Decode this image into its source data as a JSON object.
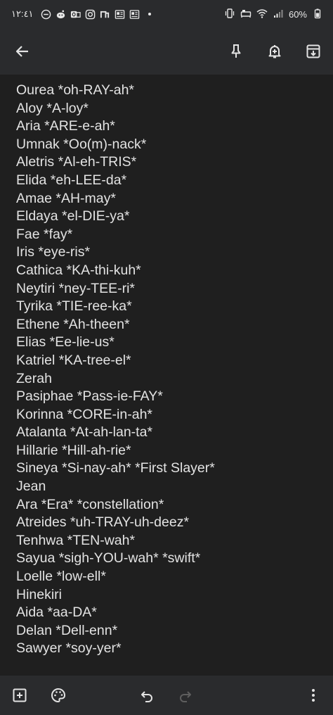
{
  "status_bar": {
    "time": "١٢:٤١",
    "left_icons": [
      "do-not-disturb-icon",
      "reddit-icon",
      "outlook-icon",
      "instagram-icon",
      "app-icon",
      "news-icon",
      "news-icon"
    ],
    "battery": "60%",
    "right_icons": [
      "vibrate-icon",
      "alarm-icon",
      "wifi-icon",
      "signal-icon",
      "battery-icon"
    ]
  },
  "toolbar": {
    "icons": [
      "back-arrow-icon",
      "pin-icon",
      "add-reminder-icon",
      "archive-icon"
    ]
  },
  "note": {
    "lines": [
      "Ourea *oh-RAY-ah*",
      "Aloy *A-loy*",
      "Aria *ARE-e-ah*",
      "Umnak *Oo(m)-nack*",
      "Aletris *Al-eh-TRIS*",
      "Elida *eh-LEE-da*",
      "Amae *AH-may*",
      "Eldaya *el-DIE-ya*",
      "Fae *fay*",
      "Iris *eye-ris*",
      "Cathica *KA-thi-kuh*",
      "Neytiri *ney-TEE-ri*",
      "Tyrika *TIE-ree-ka*",
      "Ethene *Ah-theen*",
      "Elias *Ee-lie-us*",
      "Katriel *KA-tree-el*",
      "Zerah",
      "Pasiphae *Pass-ie-FAY*",
      "Korinna *CORE-in-ah*",
      "Atalanta *At-ah-lan-ta*",
      "Hillarie *Hill-ah-rie*",
      "Sineya *Si-nay-ah* *First Slayer*",
      "Jean",
      "Ara *Era* *constellation*",
      "Atreides *uh-TRAY-uh-deez*",
      "Tenhwa *TEN-wah*",
      "Sayua *sigh-YOU-wah* *swift*",
      "Loelle *low-ell*",
      "Hinekiri",
      "Aida *aa-DA*",
      "Delan *Dell-enn*",
      "Sawyer *soy-yer*"
    ]
  },
  "bottom_bar": {
    "icons": [
      "add-box-icon",
      "palette-icon",
      "undo-icon",
      "redo-icon",
      "more-vertical-icon"
    ]
  },
  "colors": {
    "background": "#1f1f1f",
    "bar_background": "#2a2b2d",
    "text": "#e3e3e3",
    "icon": "#e3e3e3",
    "disabled_icon": "#6b6b6b"
  }
}
